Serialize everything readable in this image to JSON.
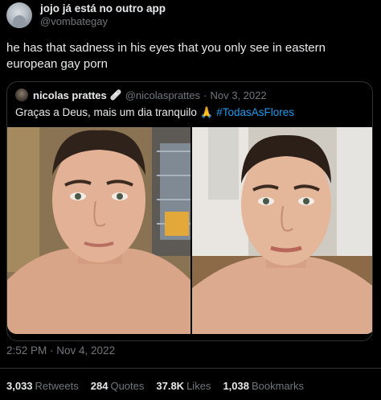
{
  "author": {
    "display_name": "jojo já está no outro app",
    "handle": "@vombategay",
    "avatar_icon": "avatar-icon"
  },
  "tweet": {
    "text": "he has that sadness in his eyes that you only see in eastern european gay porn",
    "timestamp": "2:52 PM · Nov 4, 2022"
  },
  "quote": {
    "name": "nicolas prattes",
    "emoji": "🩹",
    "handle": "@nicolasprattes",
    "date": "Nov 3, 2022",
    "separator": "·",
    "text": "Graças a Deus, mais um dia tranquilo",
    "text_emoji": "🙏",
    "hashtag": "#TodasAsFlores"
  },
  "stats": [
    {
      "value": "3,033",
      "label": "Retweets"
    },
    {
      "value": "284",
      "label": "Quotes"
    },
    {
      "value": "37.8K",
      "label": "Likes"
    },
    {
      "value": "1,038",
      "label": "Bookmarks"
    }
  ],
  "colors": {
    "background": "#000000",
    "text": "#e7e9ea",
    "muted": "#71767b",
    "link": "#1d9bf0",
    "border": "#2f3336"
  }
}
